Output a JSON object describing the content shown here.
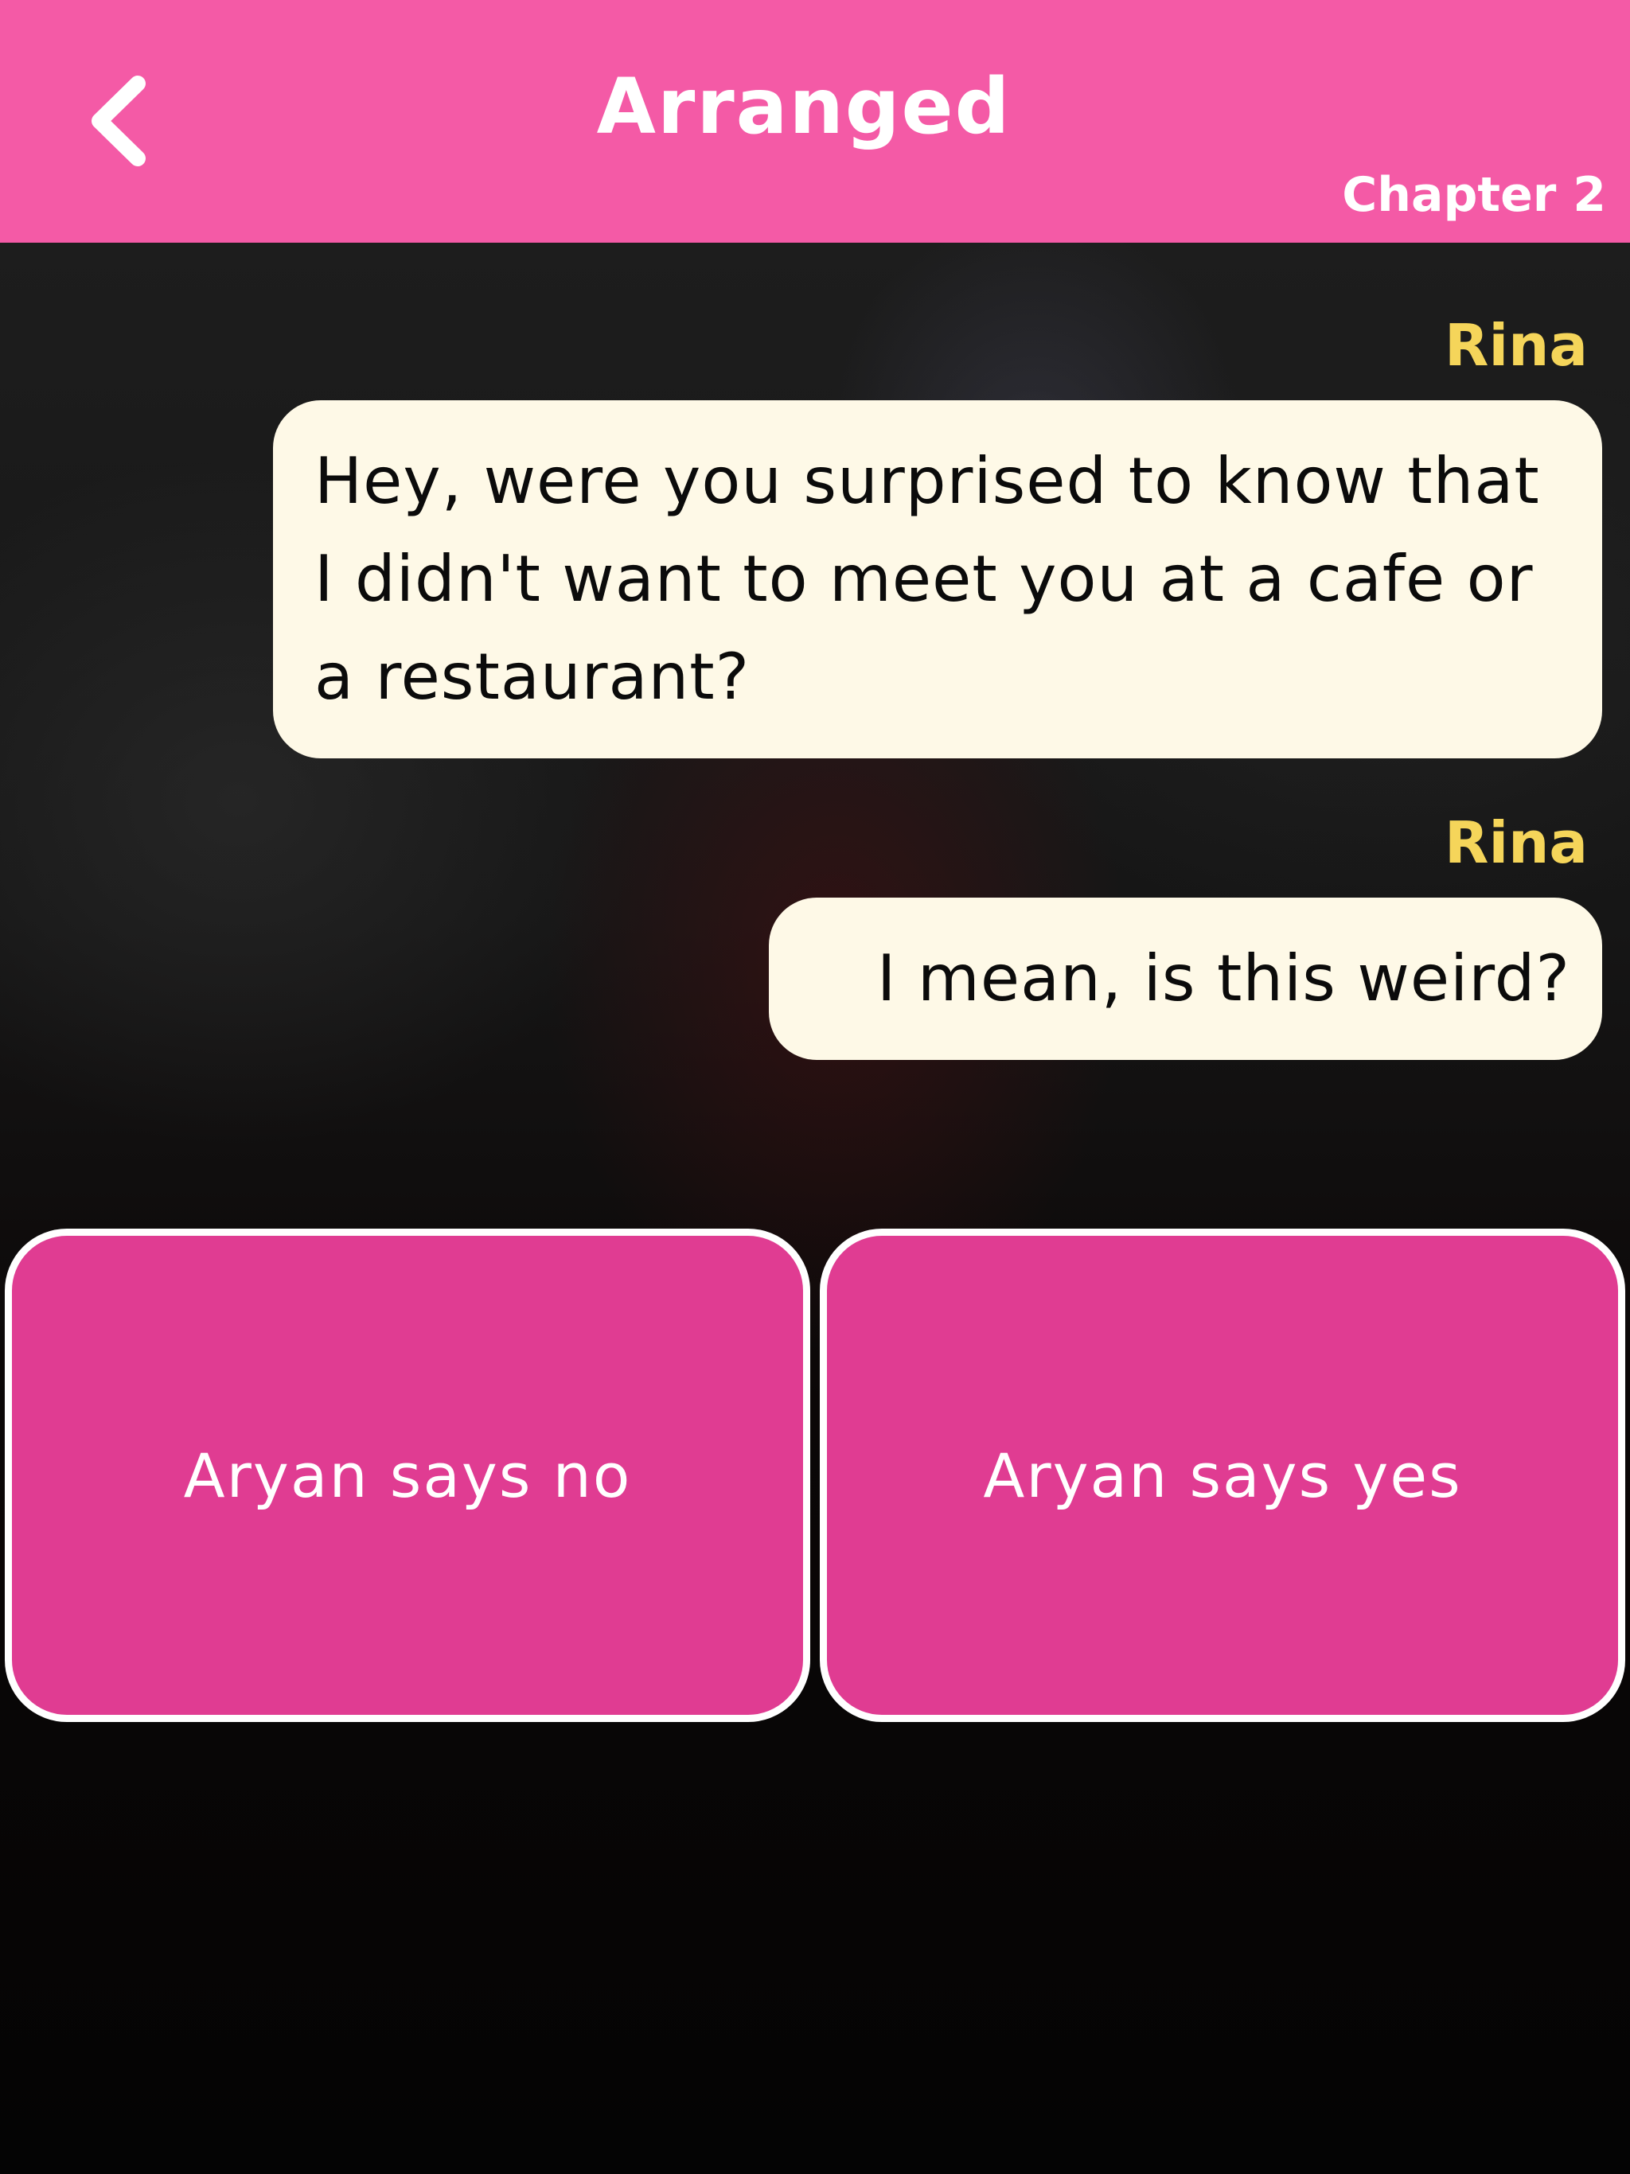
{
  "header": {
    "title": "Arranged",
    "chapter": "Chapter 2",
    "back_icon": "chevron-left-icon",
    "background_color": "#f45aa6"
  },
  "messages": [
    {
      "speaker": "Rina",
      "text": "Hey, were you surprised to know that I didn't want to meet you at a cafe or a restaurant?"
    },
    {
      "speaker": "Rina",
      "text": "I mean, is this weird?"
    }
  ],
  "choices": [
    {
      "label": "Aryan says no"
    },
    {
      "label": "Aryan says yes"
    }
  ],
  "colors": {
    "speaker_name": "#f5d55a",
    "bubble": "#fef9e7",
    "choice_button": "#e03c92"
  }
}
